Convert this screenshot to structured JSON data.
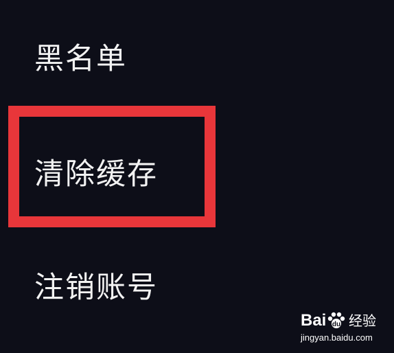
{
  "settings_menu": {
    "items": [
      {
        "label": "黑名单"
      },
      {
        "label": "清除缓存"
      },
      {
        "label": "注销账号"
      }
    ],
    "highlight_color": "#e8363a"
  },
  "watermark": {
    "brand": "Bai",
    "brand_suffix": "经验",
    "url": "jingyan.baidu.com"
  }
}
